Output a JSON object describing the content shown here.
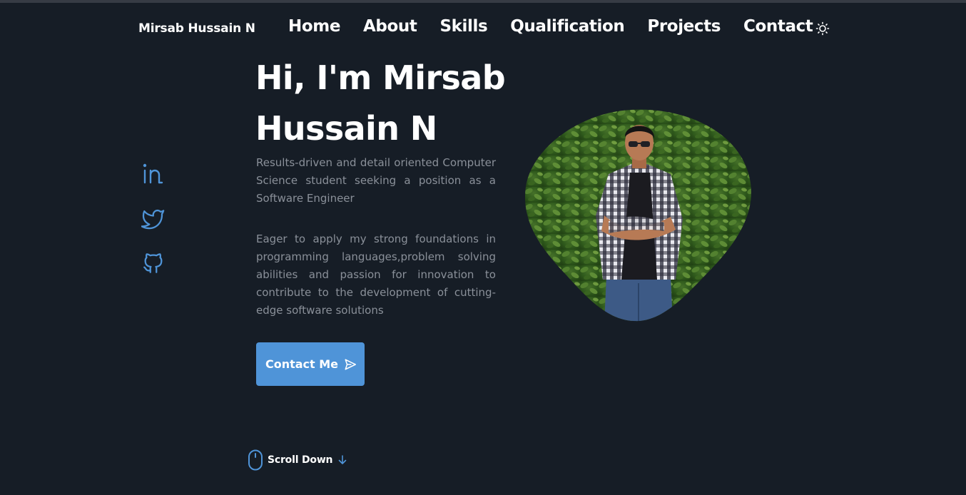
{
  "header": {
    "brand": "Mirsab Hussain N",
    "nav": [
      "Home",
      "About",
      "Skills",
      "Qualification",
      "Projects",
      "Contact"
    ],
    "theme_toggle_icon": "sun-icon"
  },
  "socials": [
    {
      "icon": "linkedin-icon"
    },
    {
      "icon": "twitter-icon"
    },
    {
      "icon": "github-icon"
    }
  ],
  "hero": {
    "title_line1": "Hi, I'm Mirsab",
    "title_line2": "Hussain N",
    "paragraph1": "Results-driven and detail oriented Computer Science student seeking a position as a Software Engineer",
    "paragraph2": "Eager to apply my strong foundations in programming languages,problem solving abilities and passion for innovation to contribute to the development of cutting-edge software solutions",
    "contact_button": "Contact Me",
    "contact_button_icon": "send-icon",
    "scroll_label": "Scroll Down",
    "scroll_icons": [
      "mouse-icon",
      "arrow-down-icon"
    ]
  },
  "colors": {
    "background": "#161d26",
    "accent": "#4f94d8",
    "text_muted": "#8a9099"
  }
}
